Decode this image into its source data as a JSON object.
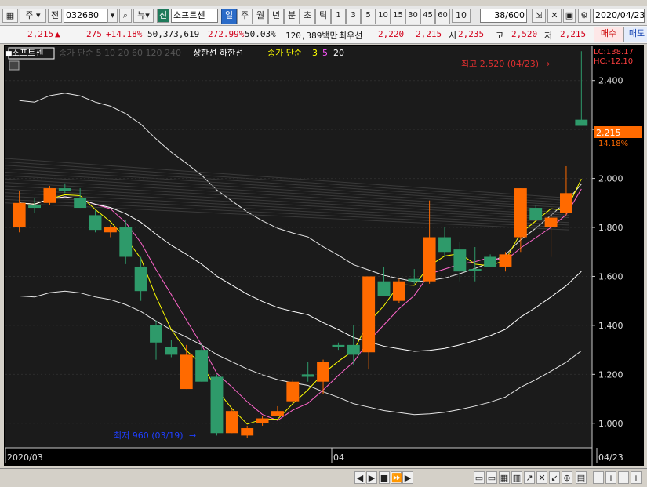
{
  "toolbar": {
    "period_week": "주",
    "prev_label": "전",
    "code": "032680",
    "news_label": "뉴",
    "new_label": "신",
    "stock_name": "소프트센",
    "periods": [
      "일",
      "주",
      "월",
      "년",
      "분",
      "초",
      "틱"
    ],
    "intervals": [
      "1",
      "3",
      "5",
      "10",
      "15",
      "30",
      "45",
      "60"
    ],
    "interval_value": "10",
    "count_display": "38/600",
    "date": "2020/04/23",
    "buy_label": "매수",
    "sell_label": "매도"
  },
  "quote": {
    "price": "2,215",
    "change": "275",
    "change_pct": "+14.18%",
    "volume": "50,373,619",
    "vol_ratio": "272.99%",
    "turnover": "50.03%",
    "amount": "120,389백만",
    "prior_label": "최우선",
    "prior_ask": "2,220",
    "prior_bid": "2,215",
    "open_label": "시",
    "open": "2,235",
    "high_label": "고",
    "high": "2,520",
    "low_label": "저",
    "low": "2,215"
  },
  "legend": {
    "stock": "소프트센",
    "hidden": "종가 단순 5 10 20 60 120 240",
    "limit": "상한선 하한선",
    "ma_prefix": "종가 단순",
    "ma1": "3",
    "ma2": "5",
    "ma3": "20"
  },
  "annotations": {
    "high": "최고 2,520 (04/23)",
    "low": "최저 960 (03/19)",
    "lc": "LC:138.17",
    "hc": "HC:-12.10",
    "price_tag": "2,215",
    "pct_tag": "14.18%"
  },
  "axis": {
    "y_labels": [
      "2,400",
      "2,200",
      "2,000",
      "1,800",
      "1,600",
      "1,400",
      "1,200",
      "1,000"
    ],
    "x_labels": [
      "2020/03",
      "04",
      "04/23"
    ]
  },
  "chart_data": {
    "type": "candlestick",
    "title": "소프트센",
    "ylim": [
      900,
      2540
    ],
    "y_ticks": [
      1000,
      1200,
      1400,
      1600,
      1800,
      2000,
      2200,
      2400
    ],
    "x_labels": [
      "2020/03",
      "04",
      "04/23"
    ],
    "candles": [
      {
        "o": 1800,
        "h": 1950,
        "l": 1780,
        "c": 1900,
        "up": true
      },
      {
        "o": 1880,
        "h": 1920,
        "l": 1860,
        "c": 1890,
        "up": false
      },
      {
        "o": 1900,
        "h": 1970,
        "l": 1890,
        "c": 1960,
        "up": true
      },
      {
        "o": 1960,
        "h": 1980,
        "l": 1940,
        "c": 1950,
        "up": false
      },
      {
        "o": 1920,
        "h": 1960,
        "l": 1880,
        "c": 1880,
        "up": false
      },
      {
        "o": 1850,
        "h": 1870,
        "l": 1780,
        "c": 1790,
        "up": false
      },
      {
        "o": 1780,
        "h": 1810,
        "l": 1760,
        "c": 1800,
        "up": true
      },
      {
        "o": 1800,
        "h": 1830,
        "l": 1650,
        "c": 1680,
        "up": false
      },
      {
        "o": 1640,
        "h": 1680,
        "l": 1500,
        "c": 1540,
        "up": false
      },
      {
        "o": 1400,
        "h": 1420,
        "l": 1260,
        "c": 1330,
        "up": false
      },
      {
        "o": 1310,
        "h": 1340,
        "l": 1270,
        "c": 1280,
        "up": false
      },
      {
        "o": 1140,
        "h": 1320,
        "l": 1140,
        "c": 1280,
        "up": true
      },
      {
        "o": 1300,
        "h": 1330,
        "l": 1170,
        "c": 1170,
        "up": false
      },
      {
        "o": 1190,
        "h": 1200,
        "l": 950,
        "c": 960,
        "up": false
      },
      {
        "o": 960,
        "h": 1060,
        "l": 960,
        "c": 1050,
        "up": true
      },
      {
        "o": 950,
        "h": 990,
        "l": 940,
        "c": 980,
        "up": true
      },
      {
        "o": 1000,
        "h": 1030,
        "l": 990,
        "c": 1020,
        "up": true
      },
      {
        "o": 1030,
        "h": 1070,
        "l": 1030,
        "c": 1050,
        "up": true
      },
      {
        "o": 1090,
        "h": 1180,
        "l": 1080,
        "c": 1170,
        "up": true
      },
      {
        "o": 1200,
        "h": 1250,
        "l": 1170,
        "c": 1190,
        "up": false
      },
      {
        "o": 1170,
        "h": 1260,
        "l": 1120,
        "c": 1250,
        "up": true
      },
      {
        "o": 1310,
        "h": 1330,
        "l": 1300,
        "c": 1320,
        "up": false
      },
      {
        "o": 1280,
        "h": 1400,
        "l": 1240,
        "c": 1320,
        "up": false
      },
      {
        "o": 1290,
        "h": 1600,
        "l": 1220,
        "c": 1600,
        "up": true
      },
      {
        "o": 1580,
        "h": 1640,
        "l": 1520,
        "c": 1520,
        "up": false
      },
      {
        "o": 1500,
        "h": 1590,
        "l": 1490,
        "c": 1580,
        "up": true
      },
      {
        "o": 1580,
        "h": 1630,
        "l": 1570,
        "c": 1590,
        "up": false
      },
      {
        "o": 1580,
        "h": 1910,
        "l": 1570,
        "c": 1760,
        "up": true
      },
      {
        "o": 1760,
        "h": 1800,
        "l": 1680,
        "c": 1700,
        "up": false
      },
      {
        "o": 1710,
        "h": 1740,
        "l": 1580,
        "c": 1620,
        "up": false
      },
      {
        "o": 1630,
        "h": 1720,
        "l": 1580,
        "c": 1630,
        "up": false
      },
      {
        "o": 1640,
        "h": 1690,
        "l": 1640,
        "c": 1680,
        "up": false
      },
      {
        "o": 1640,
        "h": 1700,
        "l": 1620,
        "c": 1690,
        "up": true
      },
      {
        "o": 1760,
        "h": 1960,
        "l": 1700,
        "c": 1960,
        "up": true
      },
      {
        "o": 1880,
        "h": 1890,
        "l": 1830,
        "c": 1830,
        "up": false
      },
      {
        "o": 1800,
        "h": 1850,
        "l": 1680,
        "c": 1840,
        "up": true
      },
      {
        "o": 1860,
        "h": 2050,
        "l": 1850,
        "c": 1940,
        "up": true
      },
      {
        "o": 2240,
        "h": 2520,
        "l": 2215,
        "c": 2215,
        "up": false
      }
    ]
  }
}
